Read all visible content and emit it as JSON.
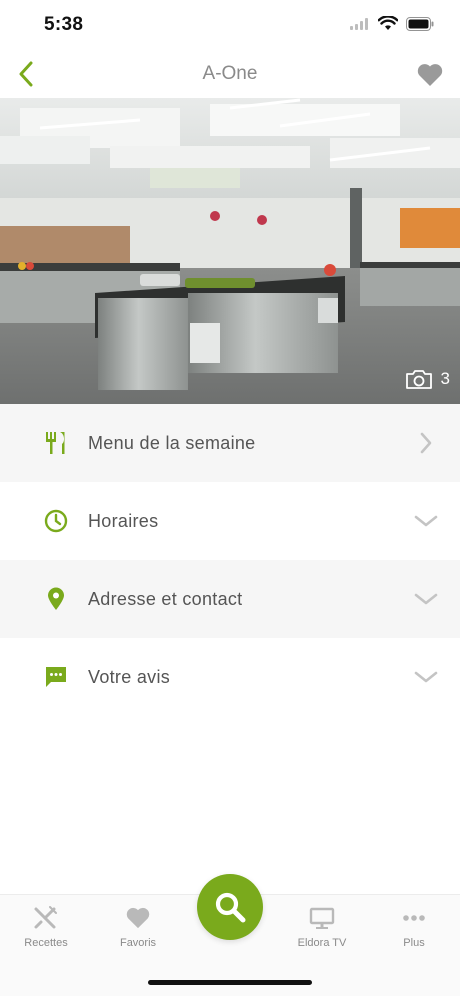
{
  "status_bar": {
    "time": "5:38"
  },
  "nav": {
    "title": "A-One"
  },
  "hero": {
    "photo_count": "3"
  },
  "menu": {
    "items": [
      {
        "label": "Menu de la semaine",
        "icon": "utensils-icon",
        "chevron": "chevron-right-icon"
      },
      {
        "label": "Horaires",
        "icon": "clock-icon",
        "chevron": "chevron-down-icon"
      },
      {
        "label": "Adresse et contact",
        "icon": "location-pin-icon",
        "chevron": "chevron-down-icon"
      },
      {
        "label": "Votre avis",
        "icon": "chat-bubble-icon",
        "chevron": "chevron-down-icon"
      }
    ]
  },
  "tab_bar": {
    "tabs": [
      {
        "label": "Recettes",
        "icon": "fork-knife-icon"
      },
      {
        "label": "Favoris",
        "icon": "heart-icon"
      },
      {
        "label": "Eldora TV",
        "icon": "monitor-icon"
      },
      {
        "label": "Plus",
        "icon": "more-dots-icon"
      }
    ],
    "center_icon": "search-icon"
  },
  "colors": {
    "accent": "#7aaa1c",
    "title_gray": "#8a8a8a",
    "row_shade": "#f6f6f6",
    "icon_gray": "#b9b9b9"
  }
}
